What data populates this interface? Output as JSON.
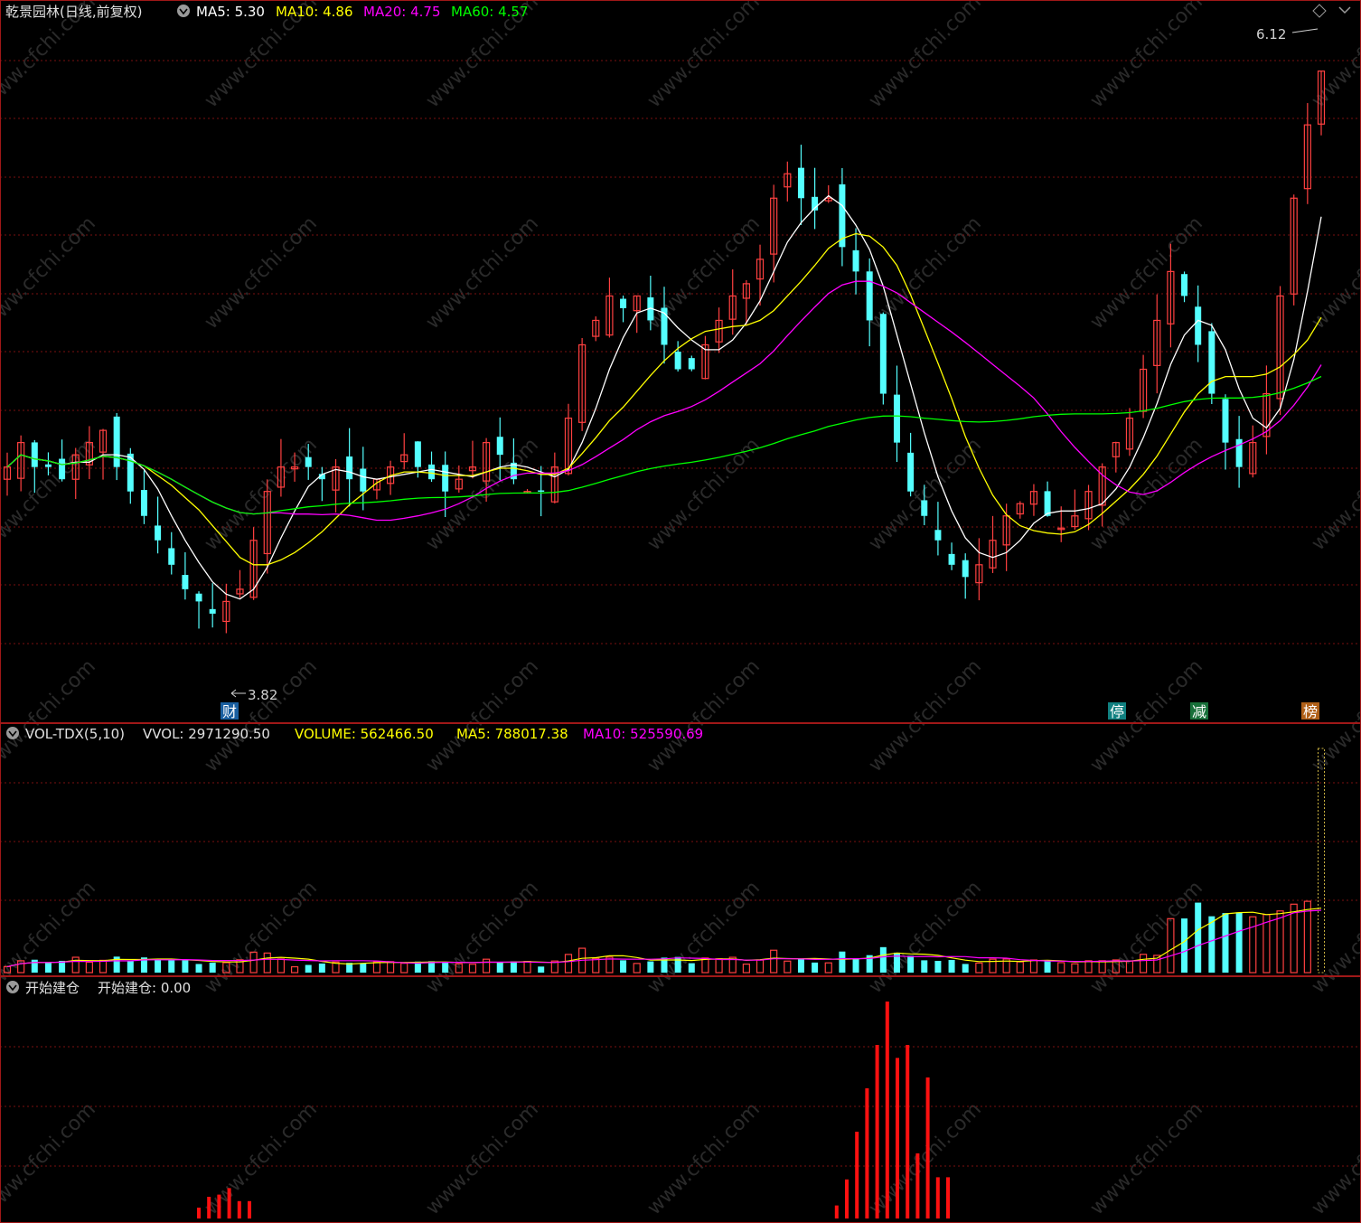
{
  "colors": {
    "background": "#000000",
    "panel_border": "#a01818",
    "grid": "#7a1010",
    "up": "#ff4040",
    "down": "#54ffff",
    "text_white": "#e0e0e0",
    "ma5": "#ffffff",
    "ma10": "#ffff00",
    "ma20": "#ff00ff",
    "ma60": "#00ff00",
    "watermark": "#2a2a2a",
    "signal": "#ff1010",
    "tag_blue": "#1a5fa0",
    "tag_teal": "#108080",
    "tag_green": "#18703a",
    "tag_orange": "#b06018"
  },
  "panel1": {
    "title": "乾景园林(日线,前复权)",
    "ma5": "MA5: 5.30",
    "ma10": "MA10: 4.86",
    "ma20": "MA20: 4.75",
    "ma60": "MA60: 4.57",
    "high_label": "6.12",
    "low_label": "3.82",
    "tags": [
      "财",
      "停",
      "减",
      "榜"
    ]
  },
  "panel2": {
    "title": "VOL-TDX(5,10)",
    "vvol": "VVOL: 2971290.50",
    "volume": "VOLUME: 562466.50",
    "ma5": "MA5: 788017.38",
    "ma10": "MA10: 525590.69"
  },
  "panel3": {
    "title": "开始建仓",
    "label": "开始建仓: 0.00"
  },
  "watermark_text": "www.cfchi.com",
  "chart_data": [
    {
      "type": "candlestick",
      "title": "乾景园林(日线,前复权)",
      "price_range": [
        3.6,
        6.3
      ],
      "annotations": {
        "high": 6.12,
        "low": 3.82
      },
      "close_trend": [
        4.5,
        4.6,
        4.5,
        4.5,
        4.45,
        4.55,
        4.6,
        4.65,
        4.5,
        4.4,
        4.3,
        4.2,
        4.1,
        4.0,
        3.95,
        3.9,
        3.95,
        4.0,
        4.2,
        4.4,
        4.5,
        4.5,
        4.5,
        4.45,
        4.5,
        4.45,
        4.4,
        4.45,
        4.5,
        4.55,
        4.5,
        4.45,
        4.4,
        4.45,
        4.5,
        4.6,
        4.55,
        4.45,
        4.4,
        4.4,
        4.5,
        4.7,
        5.0,
        5.1,
        5.2,
        5.15,
        5.2,
        5.1,
        5.0,
        4.9,
        4.9,
        5.0,
        5.1,
        5.2,
        5.25,
        5.35,
        5.6,
        5.7,
        5.6,
        5.55,
        5.6,
        5.4,
        5.3,
        5.1,
        4.8,
        4.6,
        4.4,
        4.3,
        4.2,
        4.1,
        4.05,
        4.1,
        4.2,
        4.3,
        4.35,
        4.4,
        4.3,
        4.25,
        4.3,
        4.4,
        4.5,
        4.6,
        4.7,
        4.9,
        5.1,
        5.3,
        5.2,
        5.0,
        4.8,
        4.6,
        4.5,
        4.6,
        4.8,
        5.2,
        5.6,
        5.9,
        6.12
      ]
    },
    {
      "type": "bar",
      "title": "VOL-TDX(5,10)",
      "series": [
        {
          "name": "VOLUME",
          "last": 562466.5
        },
        {
          "name": "MA5",
          "last": 788017.38
        },
        {
          "name": "MA10",
          "last": 525590.69
        }
      ]
    },
    {
      "type": "bar",
      "title": "开始建仓",
      "series": [
        {
          "name": "开始建仓",
          "last": 0.0
        }
      ]
    }
  ]
}
